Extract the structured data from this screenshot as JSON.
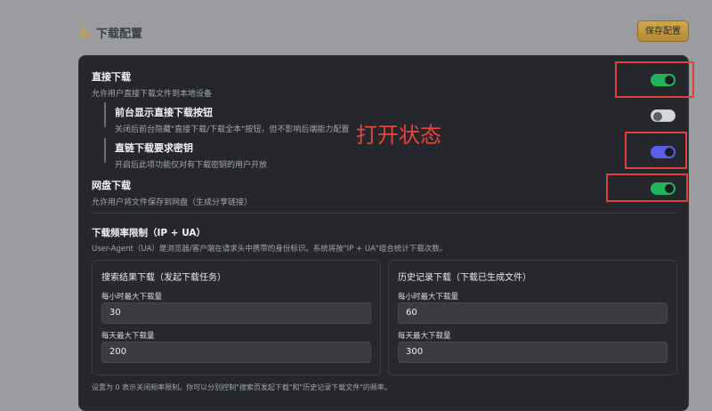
{
  "header": {
    "title": "下载配置",
    "save_label": "保存配置",
    "icon": "download-icon"
  },
  "settings": [
    {
      "id": "direct-download",
      "title": "直接下载",
      "desc": "允许用户直接下载文件到本地设备",
      "enabled": true,
      "toggle_color": "#21b45a",
      "sub": false,
      "highlighted": true
    },
    {
      "id": "show-direct-button",
      "title": "前台显示直接下载按钮",
      "desc": "关闭后前台隐藏\"直接下载/下载全本\"按钮，但不影响后端能力配置",
      "enabled": false,
      "toggle_color": "#d6d8dc",
      "sub": true,
      "highlighted": false
    },
    {
      "id": "require-key",
      "title": "直链下载要求密钥",
      "desc": "开启后此项功能仅对有下载密钥的用户开放",
      "enabled": true,
      "toggle_color": "#5a5ee6",
      "sub": true,
      "highlighted": true
    },
    {
      "id": "cloud-download",
      "title": "网盘下载",
      "desc": "允许用户将文件保存到网盘（生成分享链接）",
      "enabled": true,
      "toggle_color": "#21b45a",
      "sub": false,
      "highlighted": true
    }
  ],
  "annotation": "打开状态",
  "rate_limit": {
    "title": "下载频率限制（IP + UA）",
    "desc": "User-Agent（UA）是浏览器/客户端在请求头中携带的身份标识。系统将按\"IP + UA\"组合统计下载次数。",
    "search": {
      "title": "搜索结果下载（发起下载任务）",
      "hourly_label": "每小时最大下载量",
      "hourly_value": "30",
      "daily_label": "每天最大下载量",
      "daily_value": "200"
    },
    "history": {
      "title": "历史记录下载（下载已生成文件）",
      "hourly_label": "每小时最大下载量",
      "hourly_value": "60",
      "daily_label": "每天最大下载量",
      "daily_value": "300"
    },
    "footnote": "设置为 0 表示关闭频率限制。你可以分别控制\"搜索页发起下载\"和\"历史记录下载文件\"的频率。"
  },
  "colors": {
    "accent_gold": "#c9a046",
    "toggle_green": "#21b45a",
    "toggle_purple": "#5a5ee6",
    "annotation_red": "#e6443c"
  }
}
